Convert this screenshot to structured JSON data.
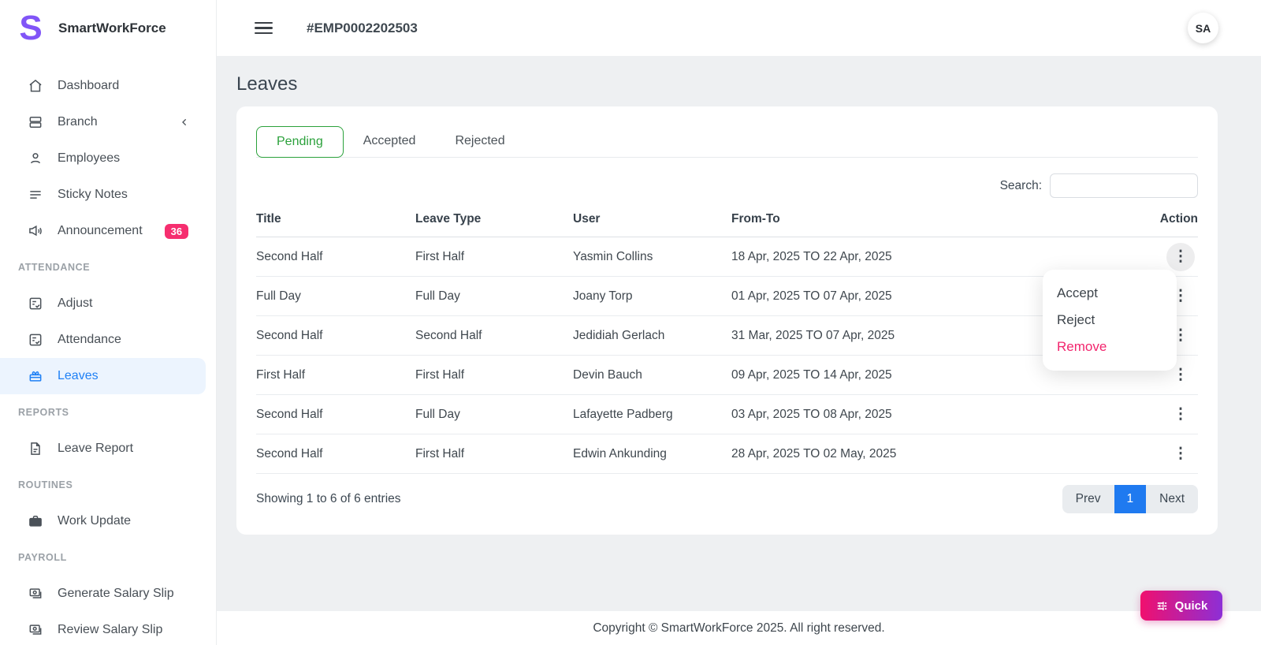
{
  "app": {
    "name": "SmartWorkForce",
    "logo_letter": "S"
  },
  "header": {
    "employee_id": "#EMP0002202503",
    "avatar_initials": "SA"
  },
  "sidebar": {
    "sections": [
      {
        "label": "",
        "items": [
          {
            "label": "Dashboard",
            "icon": "home-icon"
          },
          {
            "label": "Branch",
            "icon": "branch-icon",
            "has_chevron": true
          },
          {
            "label": "Employees",
            "icon": "employees-icon"
          },
          {
            "label": "Sticky Notes",
            "icon": "sticky-notes-icon"
          },
          {
            "label": "Announcement",
            "icon": "announcement-icon",
            "badge": "36"
          }
        ]
      },
      {
        "label": "ATTENDANCE",
        "items": [
          {
            "label": "Adjust",
            "icon": "adjust-icon"
          },
          {
            "label": "Attendance",
            "icon": "attendance-icon"
          },
          {
            "label": "Leaves",
            "icon": "leaves-icon",
            "active": true
          }
        ]
      },
      {
        "label": "REPORTS",
        "items": [
          {
            "label": "Leave Report",
            "icon": "leave-report-icon"
          }
        ]
      },
      {
        "label": "ROUTINES",
        "items": [
          {
            "label": "Work Update",
            "icon": "work-update-icon"
          }
        ]
      },
      {
        "label": "PAYROLL",
        "items": [
          {
            "label": "Generate Salary Slip",
            "icon": "generate-salary-slip-icon"
          },
          {
            "label": "Review Salary Slip",
            "icon": "review-salary-slip-icon"
          }
        ]
      }
    ]
  },
  "page": {
    "title": "Leaves"
  },
  "tabs": [
    {
      "label": "Pending",
      "active": true
    },
    {
      "label": "Accepted",
      "active": false
    },
    {
      "label": "Rejected",
      "active": false
    }
  ],
  "search": {
    "label": "Search:",
    "value": ""
  },
  "table": {
    "columns": [
      "Title",
      "Leave Type",
      "User",
      "From-To",
      "Action"
    ],
    "rows": [
      {
        "title": "Second Half",
        "leave_type": "First Half",
        "user": "Yasmin Collins",
        "from_to": "18 Apr, 2025 TO 22 Apr, 2025"
      },
      {
        "title": "Full Day",
        "leave_type": "Full Day",
        "user": "Joany Torp",
        "from_to": "01 Apr, 2025 TO 07 Apr, 2025"
      },
      {
        "title": "Second Half",
        "leave_type": "Second Half",
        "user": "Jedidiah Gerlach",
        "from_to": "31 Mar, 2025 TO 07 Apr, 2025"
      },
      {
        "title": "First Half",
        "leave_type": "First Half",
        "user": "Devin Bauch",
        "from_to": "09 Apr, 2025 TO 14 Apr, 2025"
      },
      {
        "title": "Second Half",
        "leave_type": "Full Day",
        "user": "Lafayette Padberg",
        "from_to": "03 Apr, 2025 TO 08 Apr, 2025"
      },
      {
        "title": "Second Half",
        "leave_type": "First Half",
        "user": "Edwin Ankunding",
        "from_to": "28 Apr, 2025 TO 02 May, 2025"
      }
    ],
    "summary": "Showing 1 to 6 of 6 entries"
  },
  "action_menu": {
    "items": [
      {
        "label": "Accept",
        "danger": false
      },
      {
        "label": "Reject",
        "danger": false
      },
      {
        "label": "Remove",
        "danger": true
      }
    ]
  },
  "pagination": {
    "prev": "Prev",
    "current": "1",
    "next": "Next"
  },
  "footer": {
    "copyright": "Copyright © SmartWorkForce 2025. All right reserved."
  },
  "quick_button": {
    "label": "Quick"
  },
  "colors": {
    "logo_purple": "#8155f7",
    "active_blue": "#1f80f5",
    "active_blue_bg": "#ecf4fe",
    "badge_pink": "#f62e6f",
    "tab_green": "#2ba13b",
    "remove_pink": "#f2256d",
    "pagination_blue": "#1f7af0",
    "quick_gradient_start": "#f0106e",
    "quick_gradient_end": "#8d2fd6"
  }
}
